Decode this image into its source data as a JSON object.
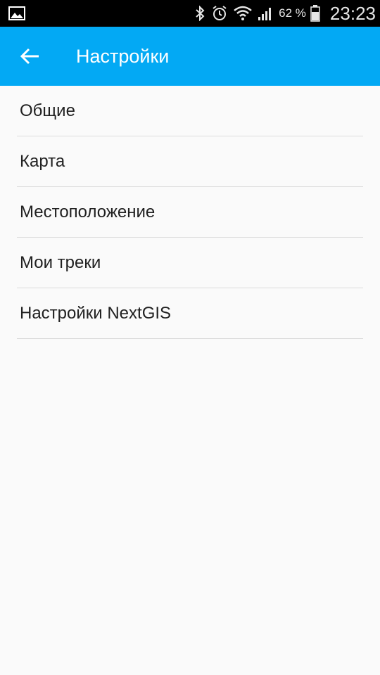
{
  "status_bar": {
    "left_icon": "gallery-icon",
    "icons": [
      "bluetooth-icon",
      "alarm-icon",
      "wifi-icon",
      "signal-icon",
      "battery-icon"
    ],
    "battery_percent": "62 %",
    "time": "23:23"
  },
  "app_bar": {
    "back_icon": "back-arrow-icon",
    "title": "Настройки",
    "color": "#03a9f4"
  },
  "settings": {
    "items": [
      {
        "label": "Общие"
      },
      {
        "label": "Карта"
      },
      {
        "label": "Местоположение"
      },
      {
        "label": "Мои треки"
      },
      {
        "label": "Настройки NextGIS"
      }
    ]
  }
}
